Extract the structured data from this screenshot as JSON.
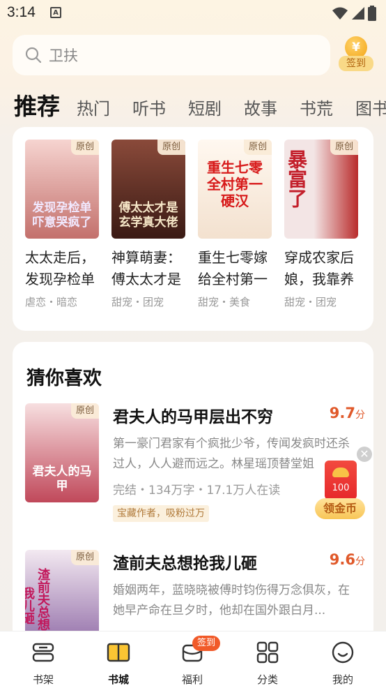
{
  "status_bar": {
    "time": "3:14",
    "notif_letter": "A"
  },
  "search": {
    "placeholder": "卫扶",
    "signin_coin": "¥",
    "signin_label": "签到"
  },
  "tabs": [
    {
      "label": "推荐"
    },
    {
      "label": "热门"
    },
    {
      "label": "听书"
    },
    {
      "label": "短剧"
    },
    {
      "label": "故事"
    },
    {
      "label": "书荒"
    },
    {
      "label": "图书"
    }
  ],
  "featured": [
    {
      "tag": "原创",
      "cover_text": "发现孕检单 吓意哭疯了",
      "title": "太太走后，发现孕检单",
      "meta": "虐恋・暗恋",
      "bg": [
        "#f6d4d0",
        "#c3706c"
      ],
      "cover_color": "#f1e9ff"
    },
    {
      "tag": "原创",
      "cover_text": "傅太太才是 玄学真大佬",
      "title": "神算萌妻：傅太太才是",
      "meta": "甜宠・团宠",
      "bg": [
        "#8a4a3a",
        "#3a1a14"
      ],
      "cover_color": "#f6e7c8"
    },
    {
      "tag": "原创",
      "cover_text": "重生七零 全村第一 硬汉",
      "title": "重生七零嫁给全村第一",
      "meta": "甜宠・美食",
      "bg": [
        "#fff8f0",
        "#f3e1cf"
      ],
      "cover_color": "#d71a1a"
    },
    {
      "tag": "原创",
      "cover_text": "暴富了",
      "title": "穿成农家后娘，我靠养",
      "meta": "甜宠・团宠",
      "bg": [
        "#f3e5e5",
        "#b92b2b"
      ],
      "cover_color": "#c31f2b"
    }
  ],
  "section": {
    "title": "猜你喜欢"
  },
  "recommendations": [
    {
      "tag": "原创",
      "cover_text": "君夫人的马甲",
      "title": "君夫人的马甲层出不穷",
      "score": "9.7",
      "score_unit": "分",
      "desc": "第一豪门君家有个疯批少爷，传闻发疯时还杀过人，人人避而远之。林星瑶顶替堂姐",
      "meta": "完结・134万字・17.1万人在读",
      "badge": "宝藏作者，吸粉过万",
      "bg": [
        "#f7dfe0",
        "#c0485a"
      ]
    },
    {
      "tag": "原创",
      "cover_text": "渣前夫总想抢我儿砸",
      "title": "渣前夫总想抢我儿砸",
      "score": "9.6",
      "score_unit": "分",
      "desc": "婚姻两年，蓝晓晓被傅时钧伤得万念俱灰，在她早产命在旦夕时，他却在国外跟白月...",
      "meta": "",
      "badge": "",
      "bg": [
        "#f3e9f1",
        "#8f6aa6"
      ]
    }
  ],
  "float_reward": {
    "close": "✕",
    "value": "100",
    "label": "领金币"
  },
  "bottom_nav": [
    {
      "label": "书架",
      "icon": "bookshelf-icon"
    },
    {
      "label": "书城",
      "icon": "bookstore-icon",
      "active": true
    },
    {
      "label": "福利",
      "icon": "gift-icon",
      "badge": "签到"
    },
    {
      "label": "分类",
      "icon": "category-icon"
    },
    {
      "label": "我的",
      "icon": "profile-icon"
    }
  ]
}
